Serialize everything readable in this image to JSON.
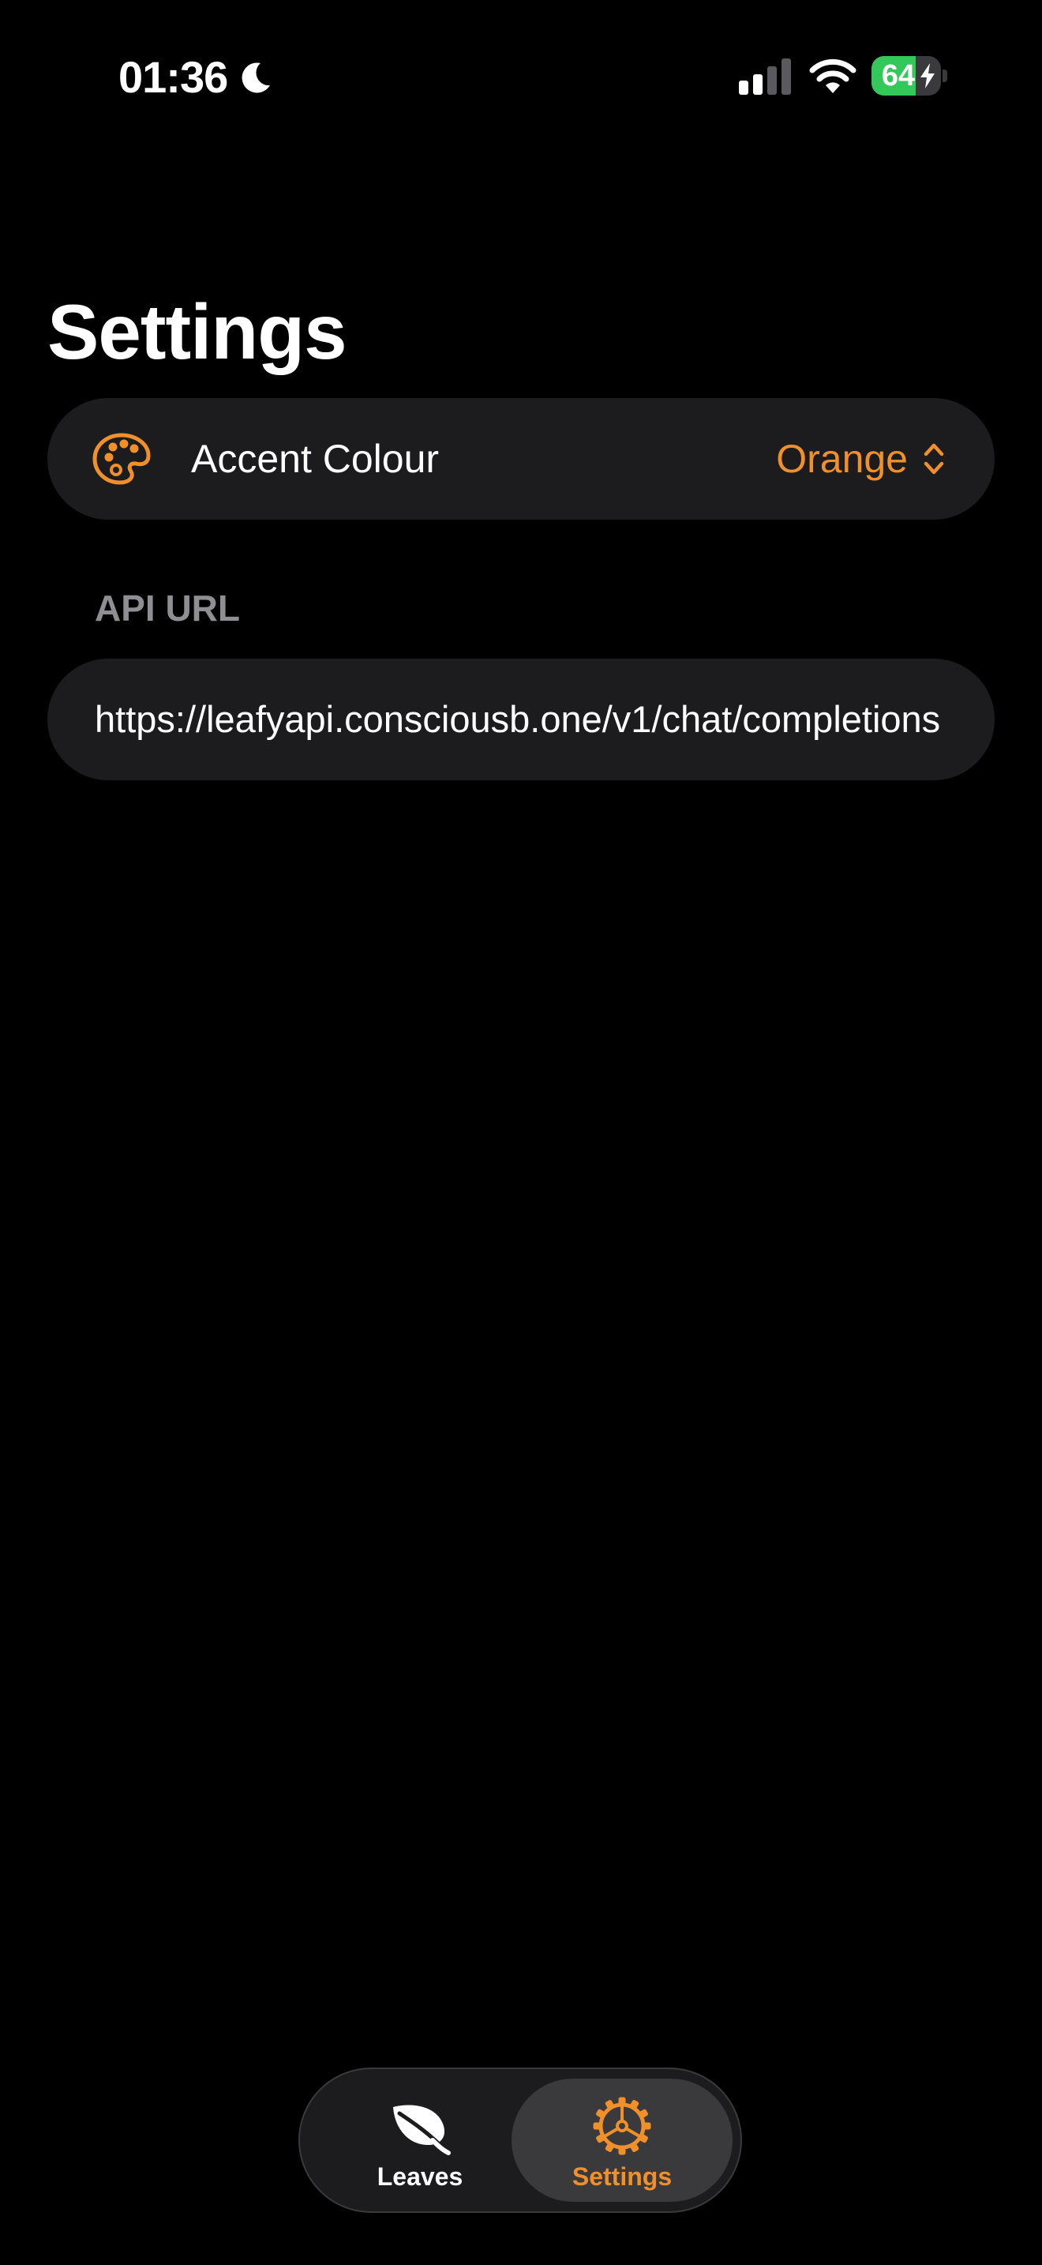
{
  "status_bar": {
    "time": "01:36",
    "battery_percent": "64",
    "battery_level": 0.64,
    "icons": [
      "moon-icon",
      "signal-icon",
      "wifi-icon",
      "battery-charging-icon"
    ]
  },
  "colors": {
    "accent": "#f0902a",
    "background": "#000000",
    "row_background": "#1c1c1e",
    "secondary_text": "#8e8e93",
    "battery_green": "#34c759"
  },
  "page": {
    "title": "Settings"
  },
  "accent_setting": {
    "icon": "palette-icon",
    "label": "Accent Colour",
    "value": "Orange",
    "control_icon": "chevron-up-down-icon"
  },
  "api_section": {
    "header": "API URL",
    "url": "https://leafyapi.consciousb.one/v1/chat/completions"
  },
  "tab_bar": {
    "selected": "settings",
    "tabs": [
      {
        "id": "leaves",
        "label": "Leaves",
        "icon": "leaf-icon"
      },
      {
        "id": "settings",
        "label": "Settings",
        "icon": "gear-icon"
      }
    ]
  }
}
